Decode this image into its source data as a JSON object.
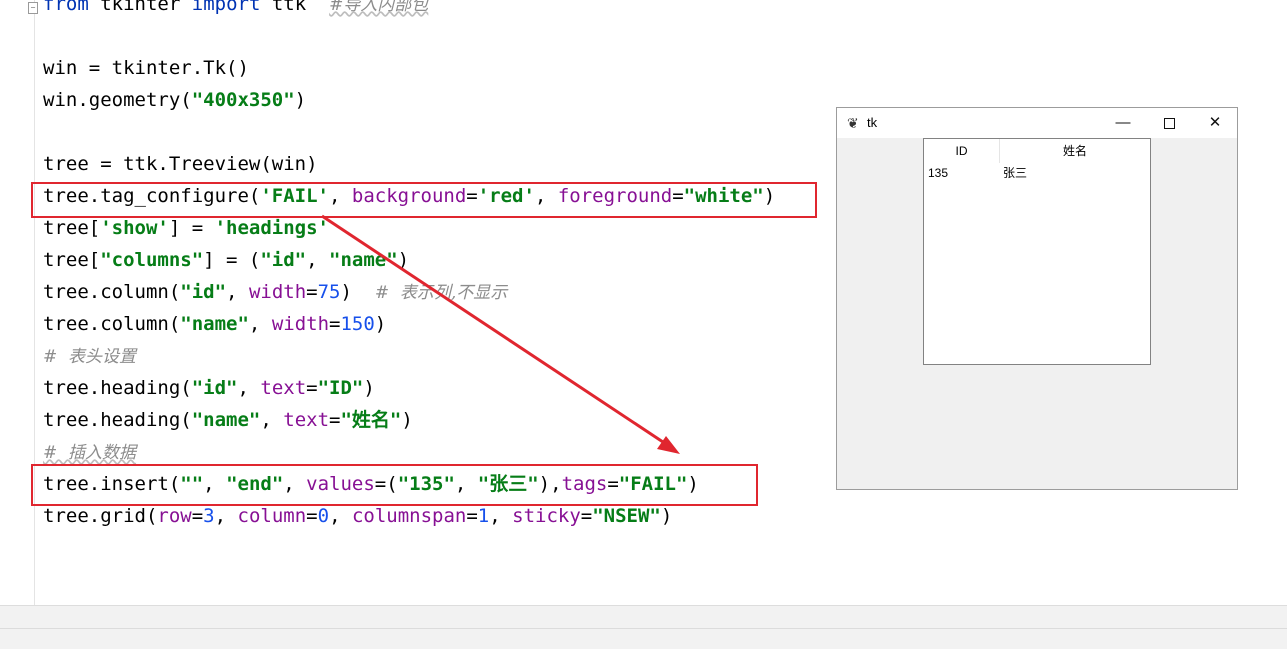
{
  "editor": {
    "lines": [
      [
        "from",
        "tkinter",
        "import",
        "ttk",
        "#导入内部包"
      ],
      [
        "win = tkinter.Tk()"
      ],
      [
        "win.geometry(",
        "\"400x350\"",
        ")"
      ],
      [
        "tree = ttk.Treeview(win)"
      ],
      [
        "tree.tag_configure(",
        "'FAIL'",
        ", ",
        "background",
        "=",
        "'red'",
        ", ",
        "foreground",
        "=",
        "\"white\"",
        ")"
      ],
      [
        "tree[",
        "'show'",
        "] = ",
        "'headings'"
      ],
      [
        "tree[",
        "\"columns\"",
        "] = (",
        "\"id\"",
        ", ",
        "\"name\"",
        ")"
      ],
      [
        "tree.column(",
        "\"id\"",
        ", ",
        "width",
        "=",
        "75",
        ")",
        "#  表示列,不显示"
      ],
      [
        "tree.column(",
        "\"name\"",
        ", ",
        "width",
        "=",
        "150",
        ")"
      ],
      [
        "#  表头设置"
      ],
      [
        "tree.heading(",
        "\"id\"",
        ", ",
        "text",
        "=",
        "\"ID\"",
        ")"
      ],
      [
        "tree.heading(",
        "\"name\"",
        ", ",
        "text",
        "=",
        "\"姓名\"",
        ")"
      ],
      [
        "#  插入数据"
      ],
      [
        "tree.insert(",
        "\"\"",
        ", ",
        "\"end\"",
        ", ",
        "values",
        "=(",
        "\"135\"",
        ", ",
        "\"张三\"",
        "),",
        "tags",
        "=",
        "\"FAIL\"",
        ")"
      ],
      [
        "tree.grid(",
        "row",
        "=",
        "3",
        ", ",
        "column",
        "=",
        "0",
        ", ",
        "columnspan",
        "=",
        "1",
        ", ",
        "sticky",
        "=",
        "\"NSEW\"",
        ")"
      ]
    ]
  },
  "tk_window": {
    "title": "tk",
    "minimize": "—",
    "close": "✕",
    "headings": {
      "id": "ID",
      "name": "姓名"
    },
    "rows": [
      {
        "id": "135",
        "name": "张三"
      }
    ]
  },
  "colors": {
    "keyword": "#0033b3",
    "string": "#067d17",
    "kwarg": "#871094",
    "number": "#1750eb",
    "comment": "#8c8c8c",
    "highlight_box": "#e0262f"
  },
  "icons": {
    "app": "feather-icon",
    "maximize": "square-icon"
  }
}
